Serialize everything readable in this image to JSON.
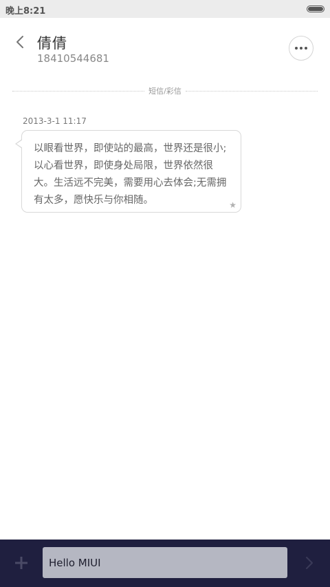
{
  "status_bar": {
    "time": "晚上8:21"
  },
  "header": {
    "back_icon": "chevron-left-icon",
    "contact_name": "倩倩",
    "contact_number": "18410544681",
    "more_icon": "more-dots-icon"
  },
  "divider": {
    "label": "短信/彩信"
  },
  "messages": [
    {
      "timestamp": "2013-3-1 11:17",
      "text": "以眼看世界，即使站的最高，世界还是很小;以心看世界，即使身处局限，世界依然很大。生活远不完美，需要用心去体会;无需拥有太多，愿快乐与你相随。",
      "star_icon": "star-icon"
    }
  ],
  "compose": {
    "add_icon": "plus-icon",
    "input_value": "Hello MIUI",
    "send_icon": "send-arrow-icon"
  },
  "colors": {
    "status_bar_bg": "#ececec",
    "compose_bar_bg": "#1f1f3f",
    "input_bg": "#b5b7c2",
    "bubble_border": "#d8d8d8"
  }
}
